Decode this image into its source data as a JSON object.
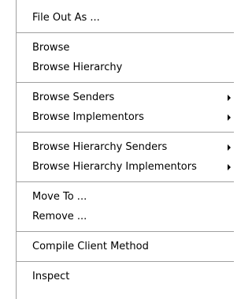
{
  "menu": {
    "items": [
      {
        "label": "File Out As ..."
      },
      {
        "label": "Browse"
      },
      {
        "label": "Browse Hierarchy"
      },
      {
        "label": "Browse Senders",
        "submenu": true
      },
      {
        "label": "Browse Implementors",
        "submenu": true
      },
      {
        "label": "Browse Hierarchy Senders",
        "submenu": true
      },
      {
        "label": "Browse Hierarchy Implementors",
        "submenu": true
      },
      {
        "label": "Move To ..."
      },
      {
        "label": "Remove ..."
      },
      {
        "label": "Compile Client Method"
      },
      {
        "label": "Inspect"
      }
    ]
  },
  "colors": {
    "background": "#ffffff",
    "text": "#000000",
    "separator": "#a0a0a0"
  },
  "icons": {
    "submenu": "triangle-right-icon"
  }
}
